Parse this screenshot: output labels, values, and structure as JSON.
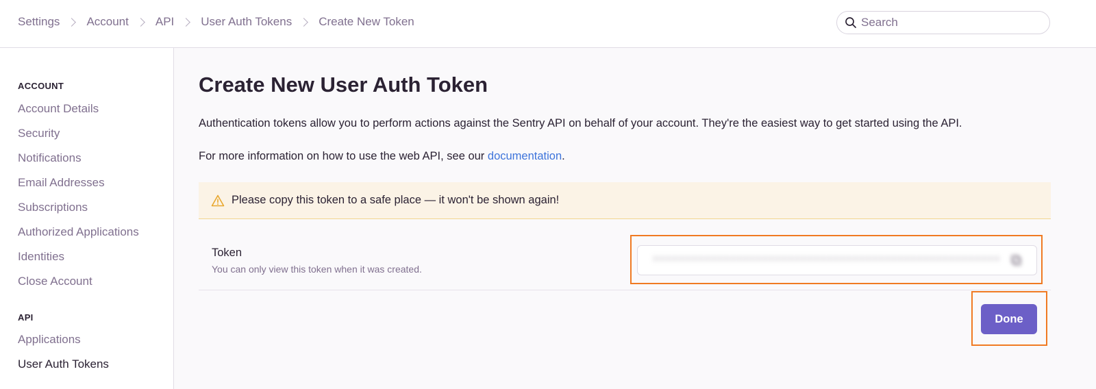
{
  "breadcrumb": [
    "Settings",
    "Account",
    "API",
    "User Auth Tokens",
    "Create New Token"
  ],
  "search": {
    "placeholder": "Search"
  },
  "sidebar": {
    "account_title": "ACCOUNT",
    "account_items": [
      "Account Details",
      "Security",
      "Notifications",
      "Email Addresses",
      "Subscriptions",
      "Authorized Applications",
      "Identities",
      "Close Account"
    ],
    "api_title": "API",
    "api_items": [
      "Applications",
      "User Auth Tokens"
    ],
    "active_item": "User Auth Tokens"
  },
  "main": {
    "title": "Create New User Auth Token",
    "description": "Authentication tokens allow you to perform actions against the Sentry API on behalf of your account. They're the easiest way to get started using the API.",
    "info_prefix": "For more information on how to use the web API, see our ",
    "info_link": "documentation",
    "info_suffix": ".",
    "alert": "Please copy this token to a safe place — it won't be shown again!",
    "token_label": "Token",
    "token_help": "You can only view this token when it was created.",
    "token_value": "••••••••••••••••••••••••••••••••••••••••••••••••••••••",
    "done_label": "Done"
  },
  "colors": {
    "accent": "#6c5fc7",
    "link": "#3d74db",
    "highlight": "#f07a22",
    "alert_bg": "#fbf3e6",
    "warning": "#e8a72d"
  },
  "icons": {
    "search": "search-icon",
    "warning": "warning-icon",
    "copy": "copy-icon"
  }
}
